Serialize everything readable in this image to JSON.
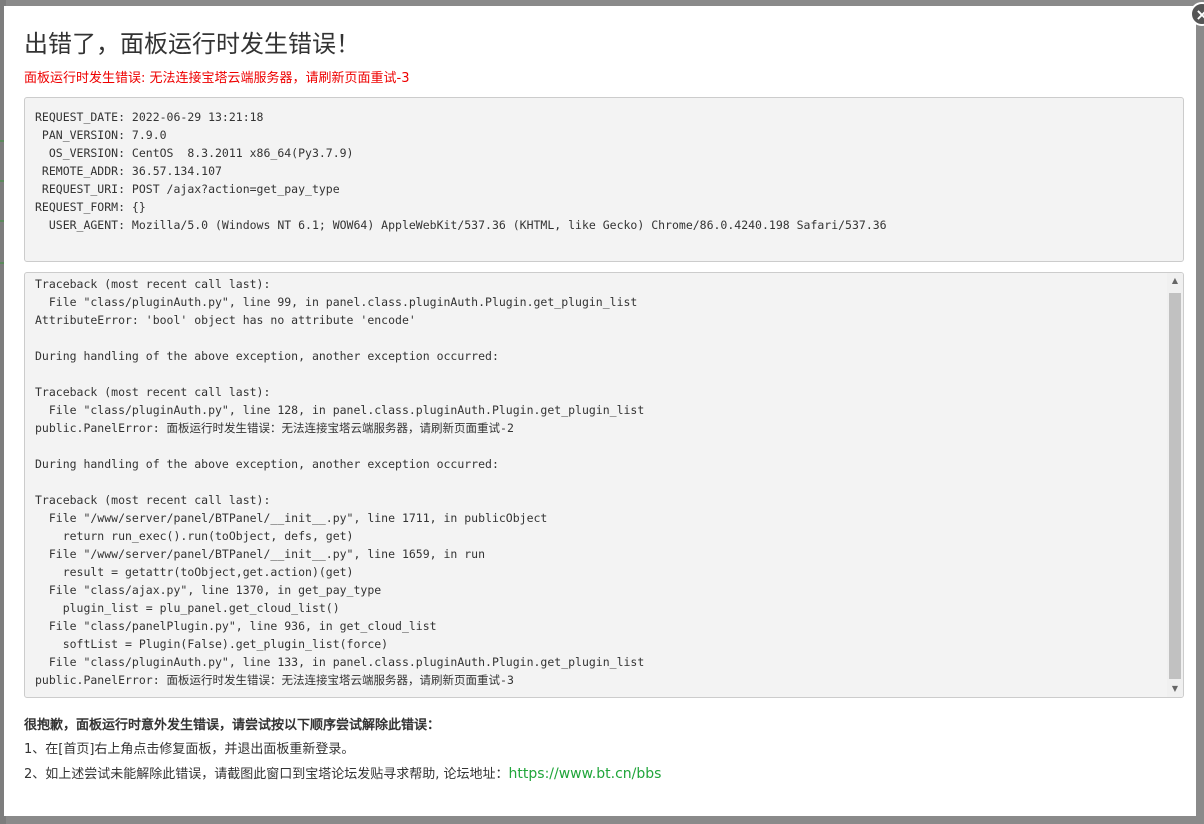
{
  "dialog": {
    "close_symbol": "×",
    "title": "出错了，面板运行时发生错误！",
    "subtitle": "面板运行时发生错误: 无法连接宝塔云端服务器，请刷新页面重试-3"
  },
  "request_info": [
    {
      "key": "REQUEST_DATE",
      "value": "2022-06-29 13:21:18"
    },
    {
      "key": "PAN_VERSION",
      "value": "7.9.0"
    },
    {
      "key": "OS_VERSION",
      "value": "CentOS  8.3.2011 x86_64(Py3.7.9)"
    },
    {
      "key": "REMOTE_ADDR",
      "value": "36.57.134.107"
    },
    {
      "key": "REQUEST_URI",
      "value": "POST /ajax?action=get_pay_type"
    },
    {
      "key": "REQUEST_FORM",
      "value": "{}"
    },
    {
      "key": "USER_AGENT",
      "value": "Mozilla/5.0 (Windows NT 6.1; WOW64) AppleWebKit/537.36 (KHTML, like Gecko) Chrome/86.0.4240.198 Safari/537.36"
    }
  ],
  "traceback_lines": [
    "Traceback (most recent call last):",
    "  File \"class/pluginAuth.py\", line 99, in panel.class.pluginAuth.Plugin.get_plugin_list",
    "AttributeError: 'bool' object has no attribute 'encode'",
    "",
    "During handling of the above exception, another exception occurred:",
    "",
    "Traceback (most recent call last):",
    "  File \"class/pluginAuth.py\", line 128, in panel.class.pluginAuth.Plugin.get_plugin_list",
    "public.PanelError: 面板运行时发生错误：无法连接宝塔云端服务器，请刷新页面重试-2",
    "",
    "During handling of the above exception, another exception occurred:",
    "",
    "Traceback (most recent call last):",
    "  File \"/www/server/panel/BTPanel/__init__.py\", line 1711, in publicObject",
    "    return run_exec().run(toObject, defs, get)",
    "  File \"/www/server/panel/BTPanel/__init__.py\", line 1659, in run",
    "    result = getattr(toObject,get.action)(get)",
    "  File \"class/ajax.py\", line 1370, in get_pay_type",
    "    plugin_list = plu_panel.get_cloud_list()",
    "  File \"class/panelPlugin.py\", line 936, in get_cloud_list",
    "    softList = Plugin(False).get_plugin_list(force)",
    "  File \"class/pluginAuth.py\", line 133, in panel.class.pluginAuth.Plugin.get_plugin_list",
    "public.PanelError: 面板运行时发生错误：无法连接宝塔云端服务器，请刷新页面重试-3"
  ],
  "help": {
    "heading": "很抱歉，面板运行时意外发生错误，请尝试按以下顺序尝试解除此错误：",
    "step1": "1、在[首页]右上角点击修复面板，并退出面板重新登录。",
    "step2_prefix": "2、如上述尝试未能解除此错误，请截图此窗口到宝塔论坛发贴寻求帮助, 论坛地址：",
    "forum_link": "https://www.bt.cn/bbs"
  },
  "scrollbar": {
    "up_arrow": "▲",
    "down_arrow": "▼"
  },
  "colors": {
    "error_red": "#ee0000",
    "link_green": "#20a53a"
  }
}
